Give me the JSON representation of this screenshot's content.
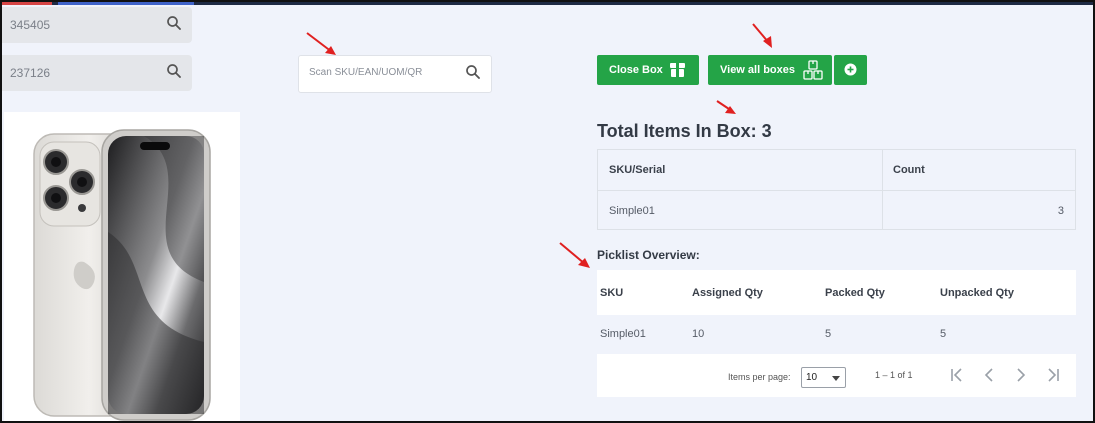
{
  "left_inputs": [
    {
      "value": "345405",
      "icon": "search-icon"
    },
    {
      "value": "237126",
      "icon": "search-icon"
    }
  ],
  "scan": {
    "placeholder": "Scan SKU/EAN/UOM/QR",
    "icon": "search-icon"
  },
  "toolbar": {
    "close_box_label": "Close Box",
    "view_all_label": "View all boxes",
    "add_icon": "plus-circle-icon"
  },
  "box": {
    "title": "Total Items In Box: 3",
    "headers": [
      "SKU/Serial",
      "Count"
    ],
    "rows": [
      [
        "Simple01",
        "3"
      ]
    ]
  },
  "picklist": {
    "title": "Picklist Overview:",
    "headers": [
      "SKU",
      "Assigned Qty",
      "Packed Qty",
      "Unpacked Qty"
    ],
    "rows": [
      [
        "Simple01",
        "10",
        "5",
        "5"
      ]
    ]
  },
  "paginator": {
    "items_per_page_label": "Items per page:",
    "page_size": "10",
    "range": "1 – 1 of 1"
  },
  "colors": {
    "accent_green": "#24a447",
    "annotation_red": "#e02020",
    "page_bg": "#f0f3fb"
  }
}
